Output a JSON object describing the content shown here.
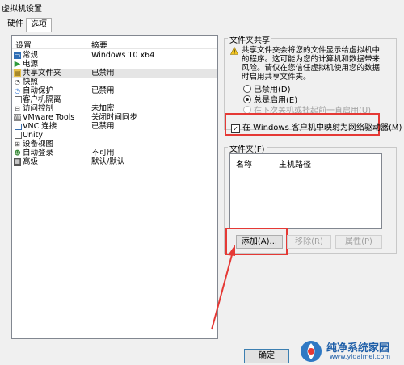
{
  "window": {
    "title": "虚拟机设置"
  },
  "tabs": [
    {
      "label": "硬件"
    },
    {
      "label": "选项"
    }
  ],
  "settings_list": {
    "col_setting": "设置",
    "col_summary": "摘要",
    "rows": [
      {
        "icon": "general-icon",
        "name": "常规",
        "summary": "Windows 10 x64"
      },
      {
        "icon": "power-icon",
        "name": "电源",
        "summary": ""
      },
      {
        "icon": "shared-folder-icon",
        "name": "共享文件夹",
        "summary": "已禁用"
      },
      {
        "icon": "snapshot-icon",
        "name": "快照",
        "summary": ""
      },
      {
        "icon": "autoprotect-icon",
        "name": "自动保护",
        "summary": "已禁用"
      },
      {
        "icon": "isolation-icon",
        "name": "客户机隔离",
        "summary": ""
      },
      {
        "icon": "access-control-icon",
        "name": "访问控制",
        "summary": "未加密"
      },
      {
        "icon": "vmware-tools-icon",
        "name": "VMware Tools",
        "summary": "关闭时间同步"
      },
      {
        "icon": "vnc-icon",
        "name": "VNC 连接",
        "summary": "已禁用"
      },
      {
        "icon": "unity-icon",
        "name": "Unity",
        "summary": ""
      },
      {
        "icon": "device-view-icon",
        "name": "设备视图",
        "summary": ""
      },
      {
        "icon": "autologin-icon",
        "name": "自动登录",
        "summary": "不可用"
      },
      {
        "icon": "advanced-icon",
        "name": "高级",
        "summary": "默认/默认"
      }
    ],
    "selected_index": 2
  },
  "folder_sharing": {
    "group_label": "文件夹共享",
    "warning_lines": [
      "共享文件夹会将您的文件显示给虚拟机中",
      "的程序。这可能为您的计算机和数据带来",
      "风险。请仅在您信任虚拟机使用您的数据",
      "时启用共享文件夹。"
    ],
    "radio_disabled": "已禁用(D)",
    "radio_always": "总是启用(E)",
    "radio_until_off": "在下次关机或挂起前一直启用(U)",
    "checkbox_map_drive": "在 Windows 客户机中映射为网络驱动器(M)"
  },
  "folders": {
    "group_label": "文件夹(F)",
    "col_name": "名称",
    "col_host_path": "主机路径",
    "add_button": "添加(A)...",
    "remove_button": "移除(R)",
    "properties_button": "属性(P)"
  },
  "footer": {
    "ok_button": "确定"
  },
  "watermark": {
    "cn": "纯净系统家园",
    "url": "www.yidaimei.com"
  },
  "colors": {
    "highlight_red": "#e53935",
    "selection": "#e5e5e5"
  }
}
